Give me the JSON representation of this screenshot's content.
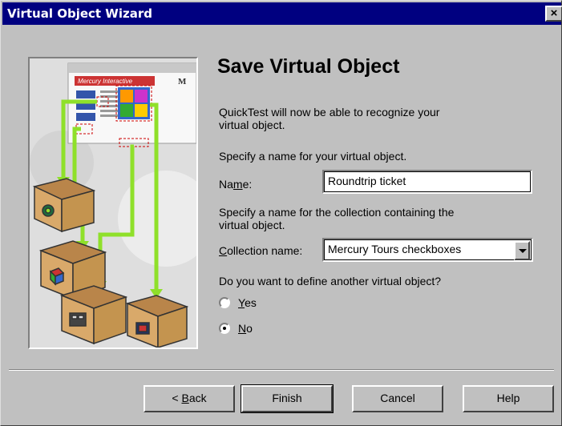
{
  "window": {
    "title": "Virtual Object Wizard",
    "close_label": "×"
  },
  "illustration": {
    "banner_text": "Mercury Interactive",
    "logo_text": "M"
  },
  "main": {
    "heading": "Save Virtual Object",
    "intro": "QuickTest will now be able to recognize your virtual object.",
    "intro_line1": "QuickTest will now be able to recognize your",
    "intro_line2": "virtual object.",
    "specify_name": "Specify a name for your virtual object.",
    "name_label_pre": "Na",
    "name_label_u": "m",
    "name_label_post": "e:",
    "name_value": "Roundtrip ticket",
    "collection_line1": "Specify a name for the collection containing the",
    "collection_line2": "virtual object.",
    "collection_label_u": "C",
    "collection_label_post": "ollection name:",
    "collection_value": "Mercury Tours checkboxes",
    "question": "Do you want to define another virtual object?",
    "yes_u": "Y",
    "yes_post": "es",
    "no_u": "N",
    "no_post": "o",
    "selected_option": "No"
  },
  "buttons": {
    "back_pre": "< ",
    "back_u": "B",
    "back_post": "ack",
    "finish": "Finish",
    "cancel": "Cancel",
    "help": "Help"
  },
  "colors": {
    "title_bar": "#000080",
    "dialog_bg": "#c0c0c0",
    "arrow_green": "#8fe02a",
    "box_tan": "#d9a96a"
  }
}
